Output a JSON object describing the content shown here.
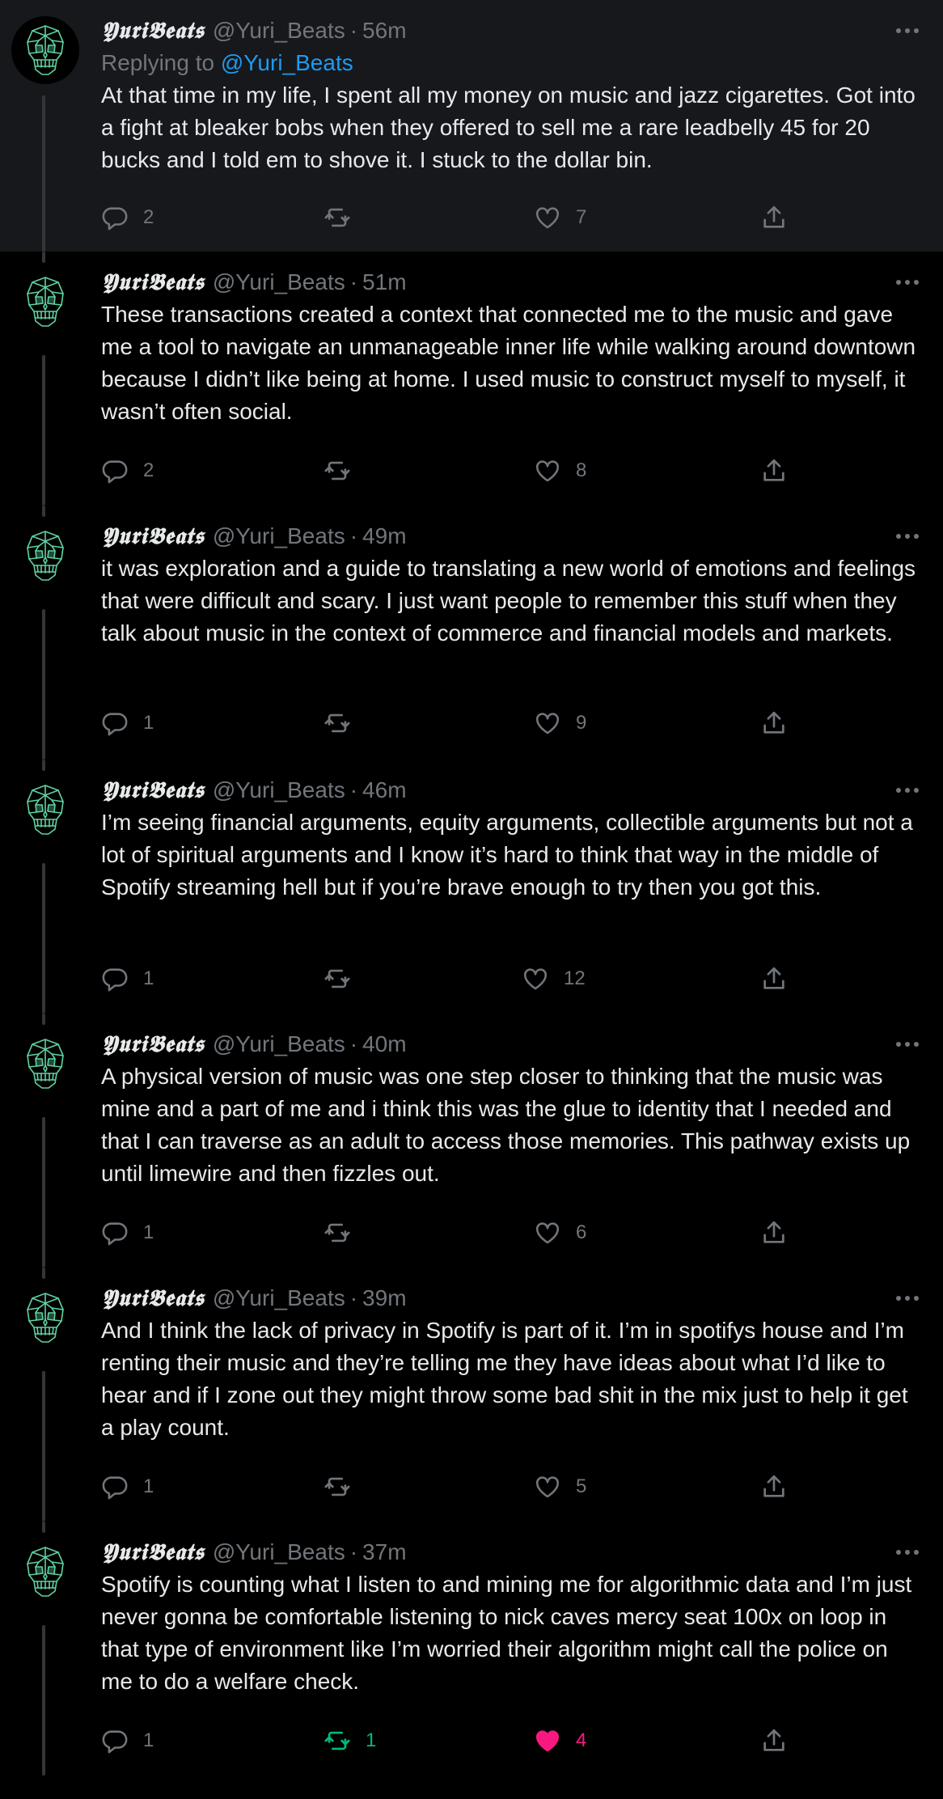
{
  "colors": {
    "background": "#000000",
    "highlight_background": "#16181c",
    "text": "#e7e9ea",
    "secondary_text": "#71767b",
    "link": "#1d9bf0",
    "retweet_active": "#00ba7c",
    "like_active": "#f91880",
    "avatar_skull": "#5fd3a0"
  },
  "tweets": [
    {
      "name": "𝖄𝖚𝖗𝖎𝕭𝖊𝖆𝖙𝖘",
      "handle": "@Yuri_Beats",
      "separator": "·",
      "time": "56m",
      "replying_prefix": "Replying to",
      "replying_to": "@Yuri_Beats",
      "text": "At that time in my life, I spent all my money on music and jazz cigarettes. Got into a fight at bleaker bobs when they offered to sell me a rare leadbelly 45 for 20 bucks and I told em to shove it. I stuck to the dollar bin.",
      "replies": "2",
      "retweets": "",
      "likes": "7"
    },
    {
      "name": "𝖄𝖚𝖗𝖎𝕭𝖊𝖆𝖙𝖘",
      "handle": "@Yuri_Beats",
      "separator": "·",
      "time": "51m",
      "text": "These transactions created a context that connected me to the music and gave me a tool to navigate an unmanageable inner life while walking around downtown because I didn’t like being at home. I used music to construct myself to myself, it wasn’t often social.",
      "replies": "2",
      "retweets": "",
      "likes": "8"
    },
    {
      "name": "𝖄𝖚𝖗𝖎𝕭𝖊𝖆𝖙𝖘",
      "handle": "@Yuri_Beats",
      "separator": "·",
      "time": "49m",
      "text": "it was exploration and a guide to translating a new world of emotions and feelings that were difficult and scary. I just want people to remember this stuff when they talk about music in the context of commerce and financial models and markets.",
      "replies": "1",
      "retweets": "",
      "likes": "9"
    },
    {
      "name": "𝖄𝖚𝖗𝖎𝕭𝖊𝖆𝖙𝖘",
      "handle": "@Yuri_Beats",
      "separator": "·",
      "time": "46m",
      "text": "I’m seeing financial arguments, equity arguments, collectible arguments but not a lot of spiritual arguments and I know it’s hard to think that way in the middle of Spotify streaming hell but if you’re brave enough to try then you got this.",
      "replies": "1",
      "retweets": "",
      "likes": "12"
    },
    {
      "name": "𝖄𝖚𝖗𝖎𝕭𝖊𝖆𝖙𝖘",
      "handle": "@Yuri_Beats",
      "separator": "·",
      "time": "40m",
      "text": "A physical version of music was one step closer to thinking that the music was mine and a part of me and i think this was the glue to identity that I needed and that I can traverse as an adult to access those memories. This pathway exists up until limewire and then fizzles out.",
      "replies": "1",
      "retweets": "",
      "likes": "6"
    },
    {
      "name": "𝖄𝖚𝖗𝖎𝕭𝖊𝖆𝖙𝖘",
      "handle": "@Yuri_Beats",
      "separator": "·",
      "time": "39m",
      "text": "And I think the lack of privacy in Spotify is part of it. I’m in spotifys house and I’m renting their music and they’re telling me they have ideas about what I’d like to hear and if I zone out they might throw some bad shit in the mix just to help it get a play count.",
      "replies": "1",
      "retweets": "",
      "likes": "5"
    },
    {
      "name": "𝖄𝖚𝖗𝖎𝕭𝖊𝖆𝖙𝖘",
      "handle": "@Yuri_Beats",
      "separator": "·",
      "time": "37m",
      "text": "Spotify is counting what I listen to and mining me for algorithmic data and I’m just never gonna be comfortable listening to nick caves mercy seat 100x on loop in that type of environment like I’m worried their algorithm might call the police on me to do a welfare check.",
      "replies": "1",
      "retweets": "1",
      "likes": "4",
      "retweeted": true,
      "liked": true
    }
  ],
  "icons": {
    "reply": "reply-icon",
    "retweet": "retweet-icon",
    "like": "heart-icon",
    "share": "share-icon",
    "more": "more-icon",
    "avatar": "skull-avatar"
  }
}
